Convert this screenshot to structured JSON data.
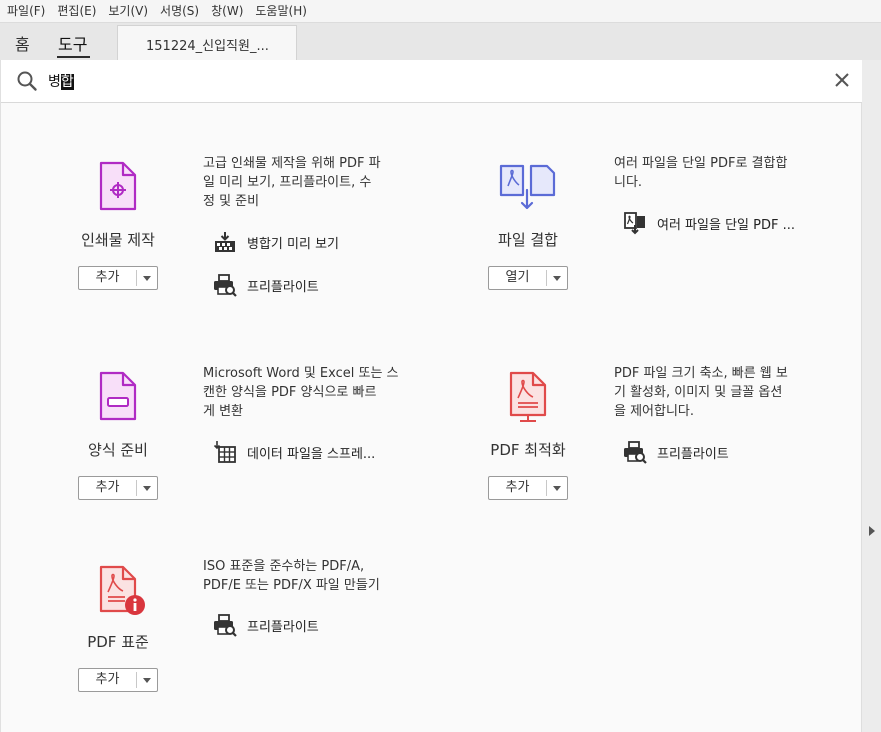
{
  "menu": [
    "파일(F)",
    "편집(E)",
    "보기(V)",
    "서명(S)",
    "창(W)",
    "도움말(H)"
  ],
  "tabs": {
    "home": "홈",
    "tools": "도구",
    "document": "151224_신입직원_..."
  },
  "search": {
    "prefix": "병",
    "selected": "합"
  },
  "tools": [
    {
      "name": "인쇄물 제작",
      "button": "추가",
      "description": [
        "고급 인쇄물 제작을 위해 PDF 파",
        "일 미리 보기, 프리플라이트, 수",
        "정 및 준비"
      ],
      "subtools": [
        {
          "label": "병합기 미리 보기",
          "icon": "output-preview-icon"
        },
        {
          "label": "프리플라이트",
          "icon": "preflight-icon"
        }
      ],
      "icon": "print-production-icon",
      "color": "#b02bc4"
    },
    {
      "name": "파일 결합",
      "button": "열기",
      "description": [
        "여러 파일을 단일 PDF로 결합합",
        "니다."
      ],
      "subtools": [
        {
          "label": "여러 파일을 단일 PDF ...",
          "icon": "combine-files-icon"
        }
      ],
      "icon": "combine-files-icon",
      "color": "#5b6bd6"
    },
    {
      "name": "양식 준비",
      "button": "추가",
      "description": [
        "Microsoft Word 및 Excel 또는 스",
        "캔한 양식을 PDF 양식으로 빠르",
        "게 변환"
      ],
      "subtools": [
        {
          "label": "데이터 파일을 스프레...",
          "icon": "data-file-spreadsheet-icon"
        }
      ],
      "icon": "prepare-form-icon",
      "color": "#b02bc4"
    },
    {
      "name": "PDF 최적화",
      "button": "추가",
      "description": [
        "PDF 파일 크기 축소, 빠른 웹 보",
        "기 활성화, 이미지 및 글꼴 옵션",
        "을 제어합니다."
      ],
      "subtools": [
        {
          "label": "프리플라이트",
          "icon": "preflight-icon"
        }
      ],
      "icon": "optimize-pdf-icon",
      "color": "#e04a4a"
    },
    {
      "name": "PDF 표준",
      "button": "추가",
      "description": [
        "ISO 표준을 준수하는 PDF/A,",
        "PDF/E 또는 PDF/X 파일 만들기"
      ],
      "subtools": [
        {
          "label": "프리플라이트",
          "icon": "preflight-icon"
        }
      ],
      "icon": "pdf-standards-icon",
      "color": "#e04a4a"
    }
  ]
}
